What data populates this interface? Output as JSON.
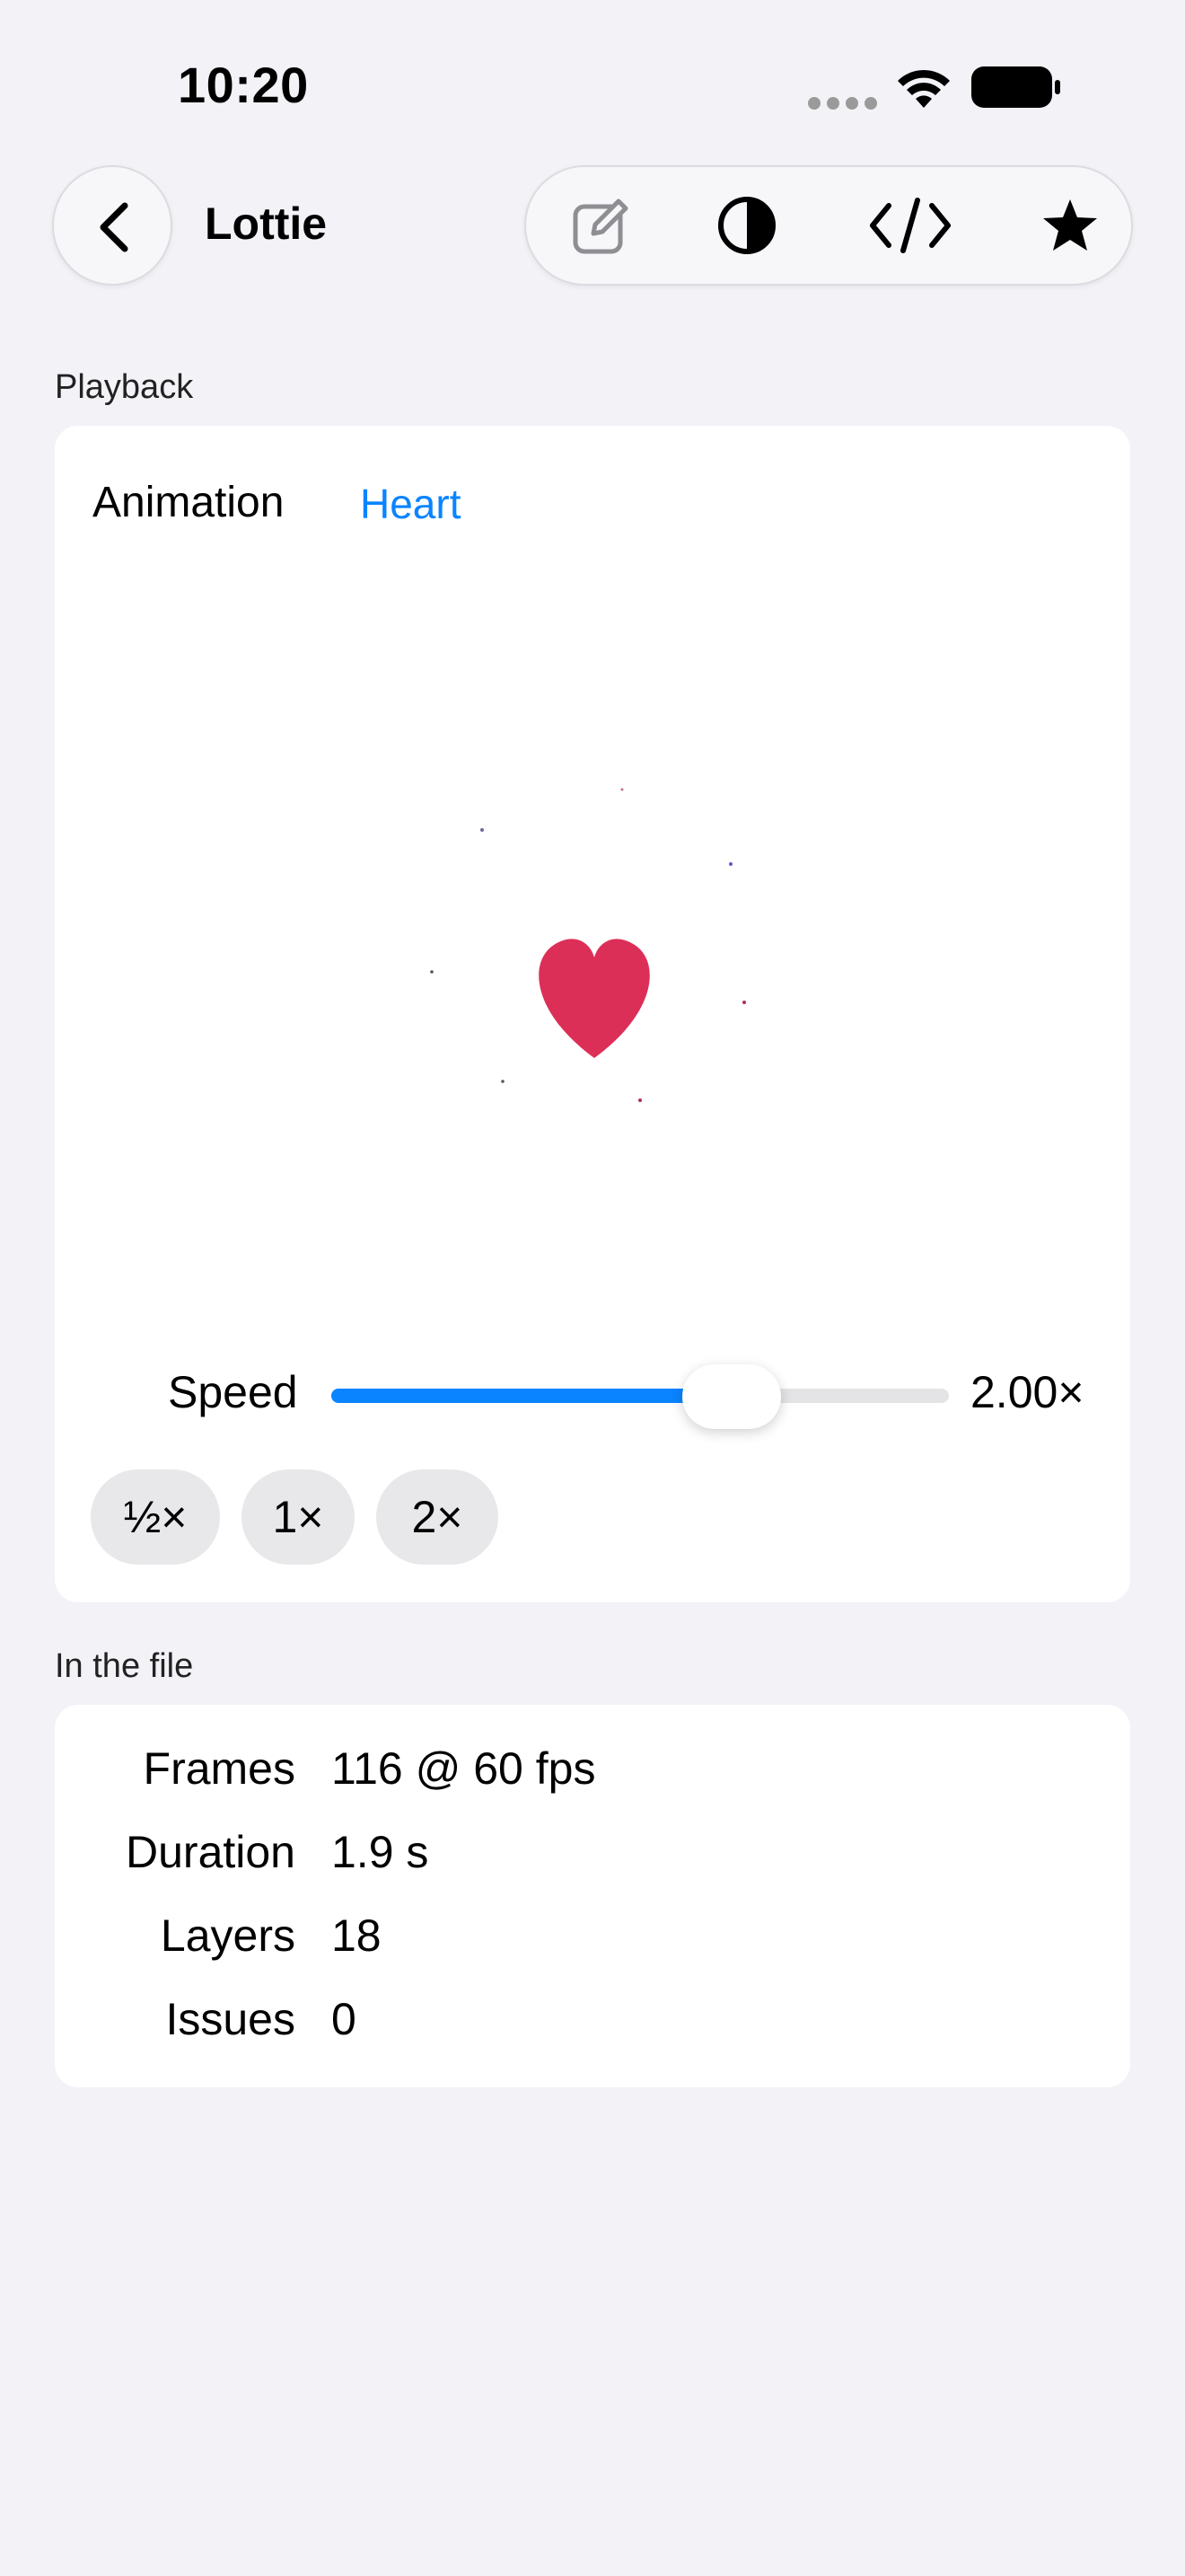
{
  "status_bar": {
    "time": "10:20",
    "icons": [
      "cellular-signal-icon",
      "wifi-icon",
      "battery-icon"
    ]
  },
  "nav": {
    "back_icon": "chevron-left-icon",
    "title": "Lottie",
    "toolbar_icons": [
      "edit-icon",
      "appearance-icon",
      "code-icon",
      "star-icon"
    ]
  },
  "playback": {
    "section_title": "Playback",
    "animation_label": "Animation",
    "animation_value": "Heart",
    "preview_icon": "heart-icon",
    "speed_label": "Speed",
    "speed_value": "2.00×",
    "speed_fraction": 0.59,
    "presets": [
      "½×",
      "1×",
      "2×"
    ]
  },
  "file_info": {
    "section_title": "In the file",
    "rows": [
      {
        "label": "Frames",
        "value": "116 @ 60 fps"
      },
      {
        "label": "Duration",
        "value": "1.9 s"
      },
      {
        "label": "Layers",
        "value": "18"
      },
      {
        "label": "Issues",
        "value": "0"
      }
    ]
  },
  "colors": {
    "accent": "#0a84ff",
    "heart": "#dc2f57",
    "background": "#f2f2f7"
  }
}
